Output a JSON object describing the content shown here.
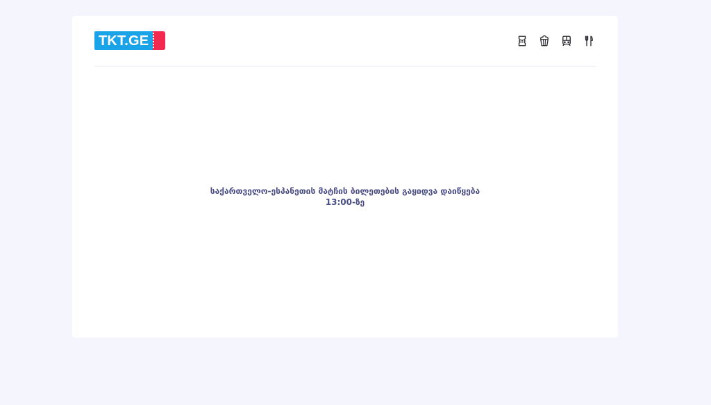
{
  "header": {
    "logo_text": "TKT.GE",
    "nav": [
      {
        "icon": "ticket-icon"
      },
      {
        "icon": "popcorn-icon"
      },
      {
        "icon": "train-icon"
      },
      {
        "icon": "fork-knife-icon"
      }
    ]
  },
  "main": {
    "message_line1": "საქართველო-ესპანეთის მატჩის ბილეთების გაყიდვა დაიწყება",
    "message_line2": "13:00-ზე"
  },
  "colors": {
    "background": "#f4f5fd",
    "card": "#ffffff",
    "logo_blue": "#1aa3e8",
    "logo_red": "#f4294f",
    "message_text": "#4a4e86"
  }
}
